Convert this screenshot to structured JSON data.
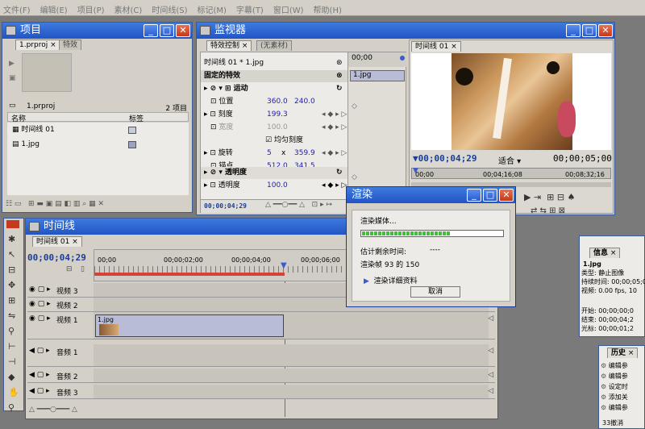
{
  "menu": [
    "文件(F)",
    "编辑(E)",
    "项目(P)",
    "素材(C)",
    "时间线(S)",
    "标记(M)",
    "字幕(T)",
    "窗口(W)",
    "帮助(H)"
  ],
  "project": {
    "title": "项目",
    "tabs": [
      "1.prproj",
      "特效"
    ],
    "file": "1.prproj",
    "count": "2 项目",
    "col_name": "名称",
    "col_label": "标签",
    "items": [
      "时间线 01",
      "1.jpg"
    ]
  },
  "monitor": {
    "title": "监视器",
    "tab1": "特效控制",
    "tab2": "(无素材)",
    "seq": "时间线 01 * 1.jpg",
    "tc_top": "00;00",
    "clip": "1.jpg",
    "fixed": "固定的特效",
    "motion": "运动",
    "rows": [
      {
        "label": "位置",
        "v1": "360.0",
        "v2": "240.0"
      },
      {
        "label": "刻度",
        "v1": "199.3",
        "v2": ""
      },
      {
        "label": "宽度",
        "v1": "100.0",
        "v2": ""
      },
      {
        "label": "均匀刻度",
        "v1": "",
        "v2": ""
      },
      {
        "label": "旋转",
        "v1": "5",
        "v2": "359.9",
        "mid": "x"
      },
      {
        "label": "锚点",
        "v1": "512.0",
        "v2": "341.5"
      }
    ],
    "opacity": "透明度",
    "opacity_row": "透明度",
    "opacity_val": "100.0",
    "tc_bottom": "00;00;04;29",
    "prog_tab": "时间线 01",
    "prog_tc": "00;00;04;29",
    "fit": "适合",
    "prog_dur": "00;00;05;00",
    "ruler": [
      "00;00",
      "00;04;16;08",
      "00;08;32;16"
    ]
  },
  "timeline": {
    "title": "时间线",
    "tab": "时间线 01",
    "tc": "00;00;04;29",
    "ruler": [
      "00;00",
      "00;00;02;00",
      "00;00;04;00",
      "00;00;06;00"
    ],
    "video": [
      "视频 3",
      "视频 2",
      "视频 1"
    ],
    "audio": [
      "音频 1",
      "音频 2",
      "音频 3"
    ],
    "clip": "1.jpg"
  },
  "render": {
    "title": "渲染",
    "media": "渲染媒体...",
    "progress": 0.62,
    "remain_label": "估计剩余时间:",
    "remain_val": "----",
    "frames": "渲染帧 93 的 150",
    "details": "渲染详细资料",
    "cancel": "取消"
  },
  "info": {
    "title": "信息",
    "file": "1.jpg",
    "lines": [
      "类型: 静止图像",
      "持续时间: 00;00;05;0",
      "视频: 0.00 fps, 10",
      "开始: 00;00;00;0",
      "结束: 00;00;04;2",
      "光标: 00;00;01;2"
    ]
  },
  "history": {
    "title": "历史",
    "items": [
      "编辑参",
      "编辑参",
      "设定时",
      "添加关",
      "编辑参"
    ],
    "footer": "33撤消"
  }
}
